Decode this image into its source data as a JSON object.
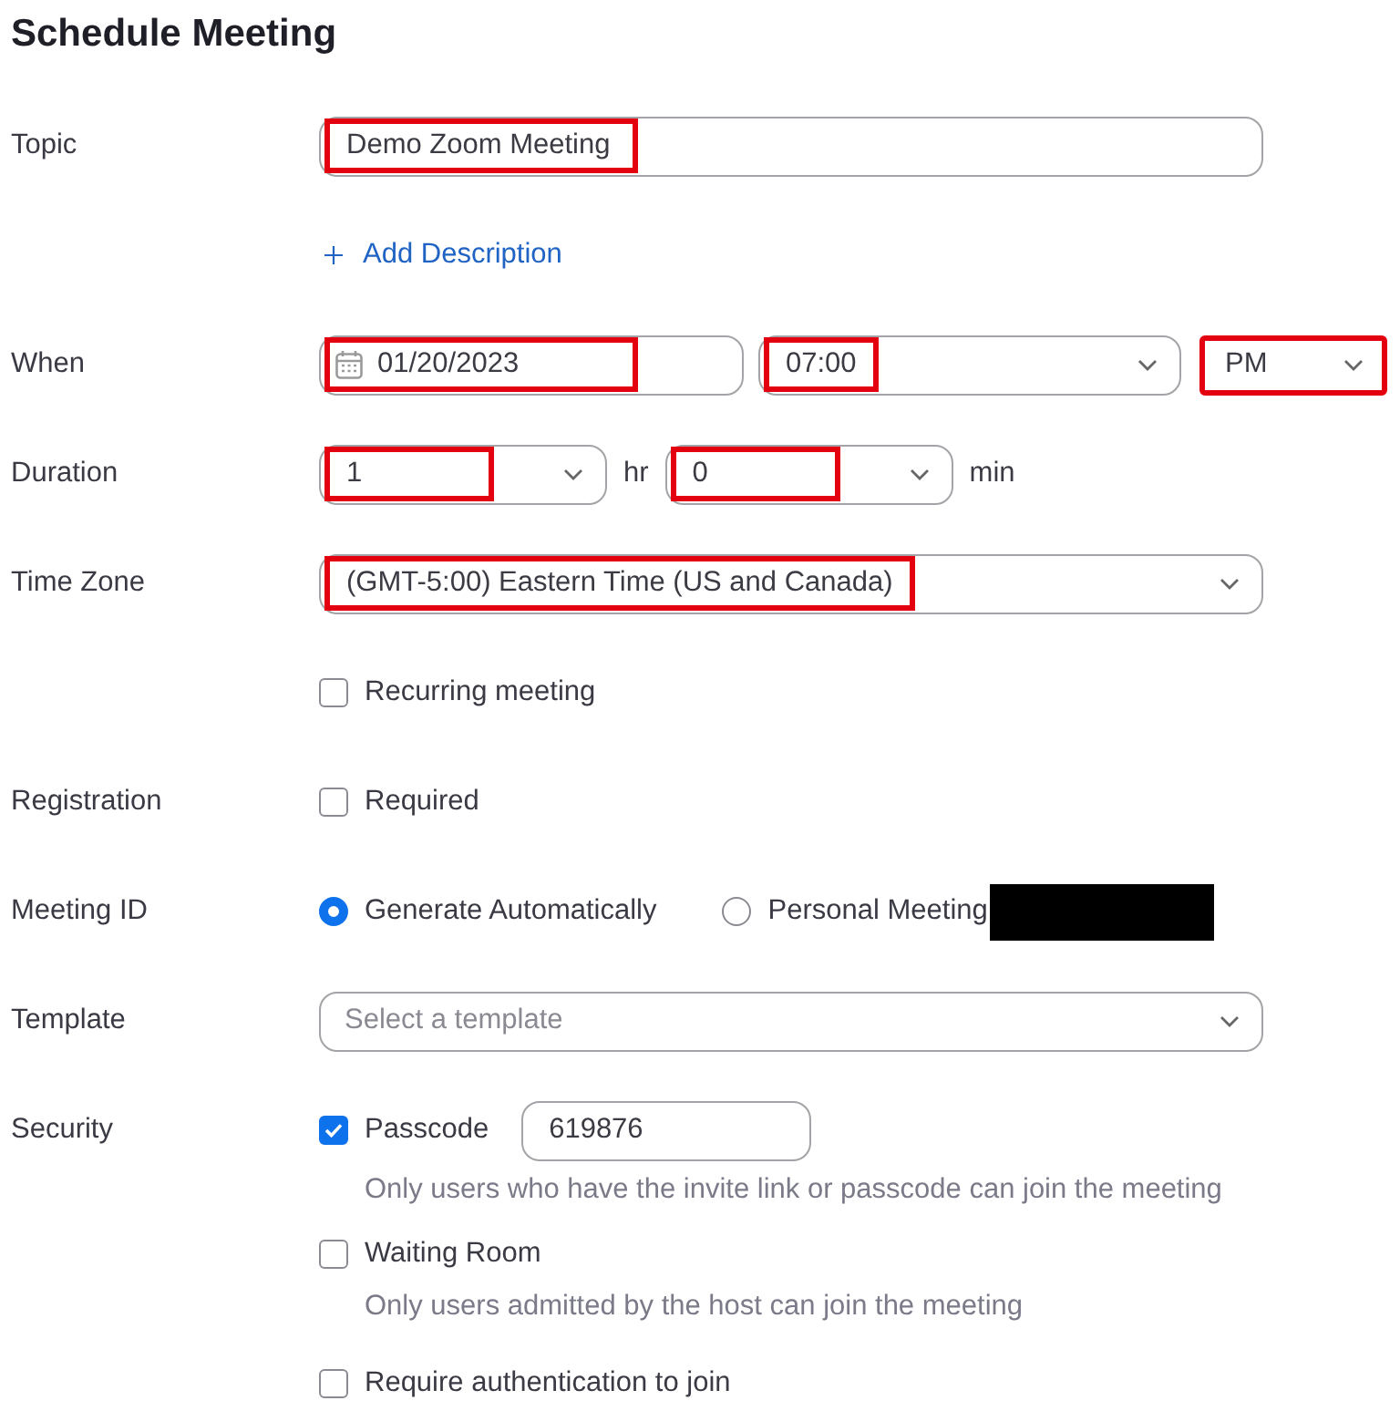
{
  "title": "Schedule Meeting",
  "topic": {
    "label": "Topic",
    "value": "Demo Zoom Meeting",
    "highlighted": true
  },
  "add_description": {
    "label": "Add Description"
  },
  "when": {
    "label": "When",
    "date": {
      "value": "01/20/2023",
      "highlighted": true
    },
    "time": {
      "value": "07:00",
      "highlighted": true
    },
    "period": {
      "value": "PM",
      "highlighted": true
    }
  },
  "duration": {
    "label": "Duration",
    "hours": {
      "value": "1",
      "unit": "hr",
      "highlighted": true
    },
    "minutes": {
      "value": "0",
      "unit": "min",
      "highlighted": true
    }
  },
  "time_zone": {
    "label": "Time Zone",
    "value": "(GMT-5:00) Eastern Time (US and Canada)",
    "highlighted": true
  },
  "recurring": {
    "label": "Recurring meeting",
    "checked": false
  },
  "registration": {
    "label": "Registration",
    "option": {
      "label": "Required",
      "checked": false
    }
  },
  "meeting_id": {
    "label": "Meeting ID",
    "options": [
      {
        "label": "Generate Automatically",
        "selected": true,
        "redacted": false
      },
      {
        "label": "Personal Meeting",
        "selected": false,
        "redacted": true
      }
    ]
  },
  "template": {
    "label": "Template",
    "placeholder": "Select a template"
  },
  "security": {
    "label": "Security",
    "options": [
      {
        "label": "Passcode",
        "checked": true,
        "value": "619876",
        "hint": "Only users who have the invite link or passcode can join the meeting"
      },
      {
        "label": "Waiting Room",
        "checked": false,
        "hint": "Only users admitted by the host can join the meeting"
      },
      {
        "label": "Require authentication to join",
        "checked": false
      }
    ]
  }
}
